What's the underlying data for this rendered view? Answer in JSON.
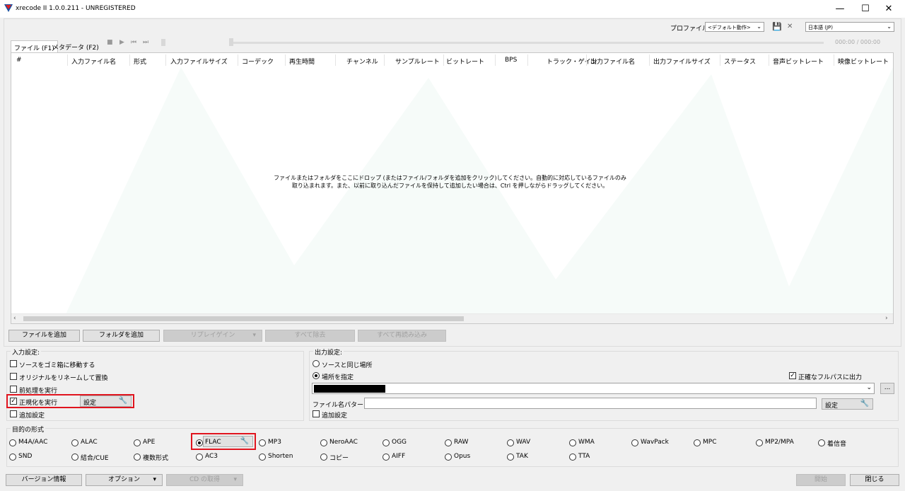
{
  "window": {
    "title": "xrecode II 1.0.0.211 - UNREGISTERED",
    "minimize": "—",
    "maximize": "☐",
    "close": "✕"
  },
  "top": {
    "profile_label": "プロファイル:",
    "profile_value": "<デフォルト動作>",
    "language_value": "日本語 (JP)",
    "time": "000:00 / 000:00"
  },
  "tabs": [
    "ファイル (F1)",
    "メタデータ (F2)"
  ],
  "columns": [
    "#",
    "入力ファイル名",
    "形式",
    "入力ファイルサイズ",
    "コーデック",
    "再生時間",
    "チャンネル",
    "サンプルレート",
    "ビットレート",
    "BPS",
    "トラック・ゲイン",
    "出力ファイル名",
    "出力ファイルサイズ",
    "ステータス",
    "音声ビットレート",
    "映像ビットレート"
  ],
  "drop_text": [
    "ファイルまたはフォルダをここにドロップ (またはファイル/フォルダを追加をクリック)してください。自動的に対応しているファイルのみ",
    "取り込まれます。また、以前に取り込んだファイルを保持して追加したい場合は、Ctrl を押しながらドラッグしてください。"
  ],
  "buttons": {
    "add_file": "ファイルを追加",
    "add_folder": "フォルダを追加",
    "replaygain": "リプレイゲイン",
    "remove_all": "すべて除去",
    "reload_all": "すべて再読み込み"
  },
  "input_settings": {
    "label": "入力設定:",
    "options": [
      "ソースをゴミ箱に移動する",
      "オリジナルをリネームして置換",
      "前処理を実行",
      "正規化を実行",
      "追加設定"
    ],
    "settings_btn": "設定"
  },
  "output_settings": {
    "label": "出力設定:",
    "same_as_source": "ソースと同じ場所",
    "specify": "場所を指定",
    "full_path": "正確なフルパスに出力",
    "browse": "...",
    "pattern_label": "ファイル名パターン:",
    "settings_btn": "設定",
    "extra": "追加設定"
  },
  "format": {
    "label": "目的の形式",
    "row1": [
      "M4A/AAC",
      "ALAC",
      "APE",
      "FLAC",
      "MP3",
      "NeroAAC",
      "OGG",
      "RAW",
      "WAV",
      "WMA",
      "WavPack",
      "MPC",
      "MP2/MPA",
      "着信音"
    ],
    "row2": [
      "SND",
      "結合/CUE",
      "複数形式",
      "AC3",
      "Shorten",
      "コピー",
      "AIFF",
      "Opus",
      "TAK",
      "TTA"
    ],
    "selected": "FLAC"
  },
  "footer": {
    "version": "バージョン情報",
    "options": "オプション",
    "cd": "CD の取得",
    "start": "開始",
    "close": "閉じる"
  }
}
